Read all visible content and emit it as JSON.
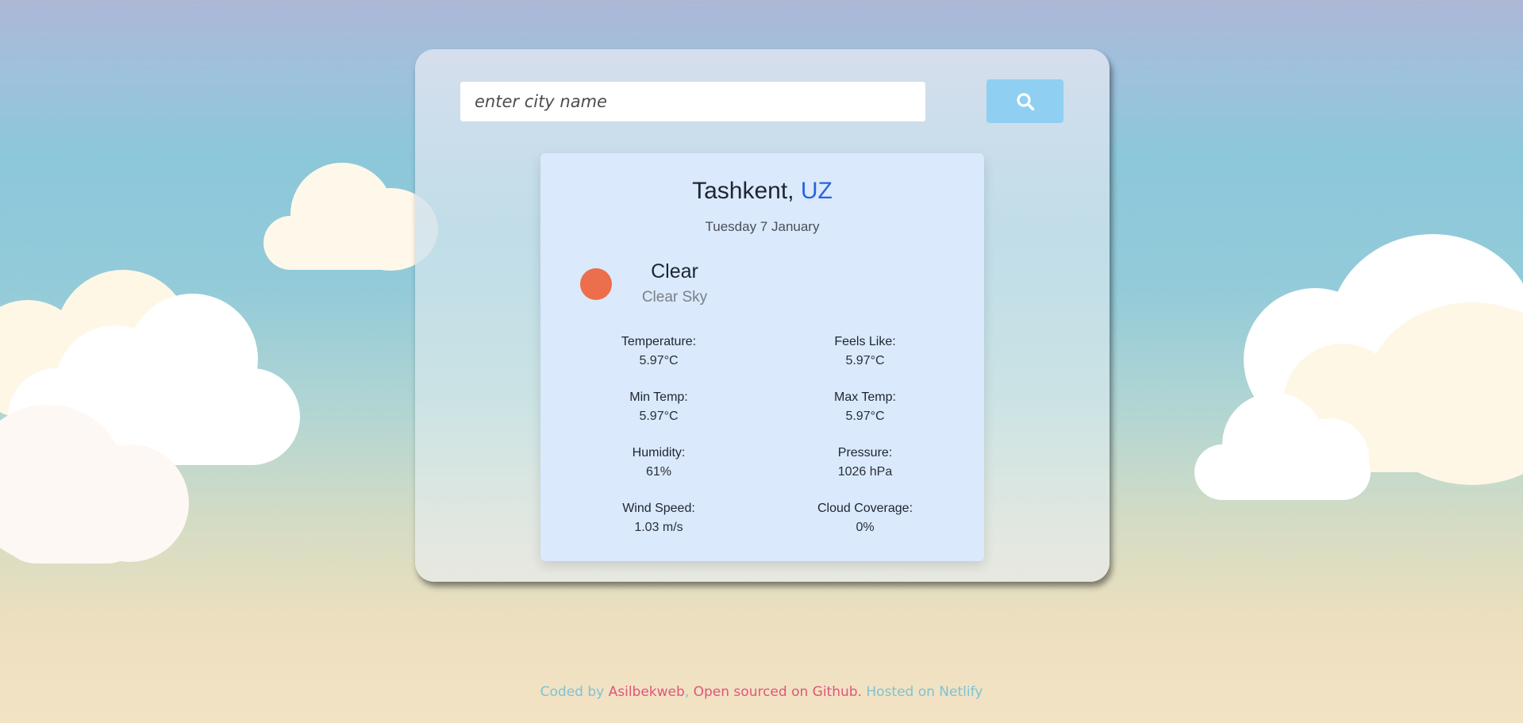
{
  "search": {
    "placeholder": "enter city name",
    "button_icon": "search-icon"
  },
  "weather": {
    "city": "Tashkent,",
    "country": "UZ",
    "date": "Tuesday 7 January",
    "icon": "sun-icon",
    "condition": "Clear",
    "description": "Clear Sky",
    "stats": [
      {
        "label": "Temperature:",
        "value": "5.97°C"
      },
      {
        "label": "Feels Like:",
        "value": "5.97°C"
      },
      {
        "label": "Min Temp:",
        "value": "5.97°C"
      },
      {
        "label": "Max Temp:",
        "value": "5.97°C"
      },
      {
        "label": "Humidity:",
        "value": "61%"
      },
      {
        "label": "Pressure:",
        "value": "1026 hPa"
      },
      {
        "label": "Wind Speed:",
        "value": "1.03 m/s"
      },
      {
        "label": "Cloud Coverage:",
        "value": "0%"
      }
    ]
  },
  "footer": {
    "prefix": "Coded by ",
    "author": "Asilbekweb",
    "separator": ", ",
    "repo_link": "Open sourced on Github.",
    "hosted": " Hosted on Netlify"
  },
  "colors": {
    "accent_blue": "#2a63e0",
    "search_button": "#8fcff1",
    "sun": "#ec6e4c",
    "footer_link": "#e0557e",
    "footer_text": "#7cc3d6"
  }
}
